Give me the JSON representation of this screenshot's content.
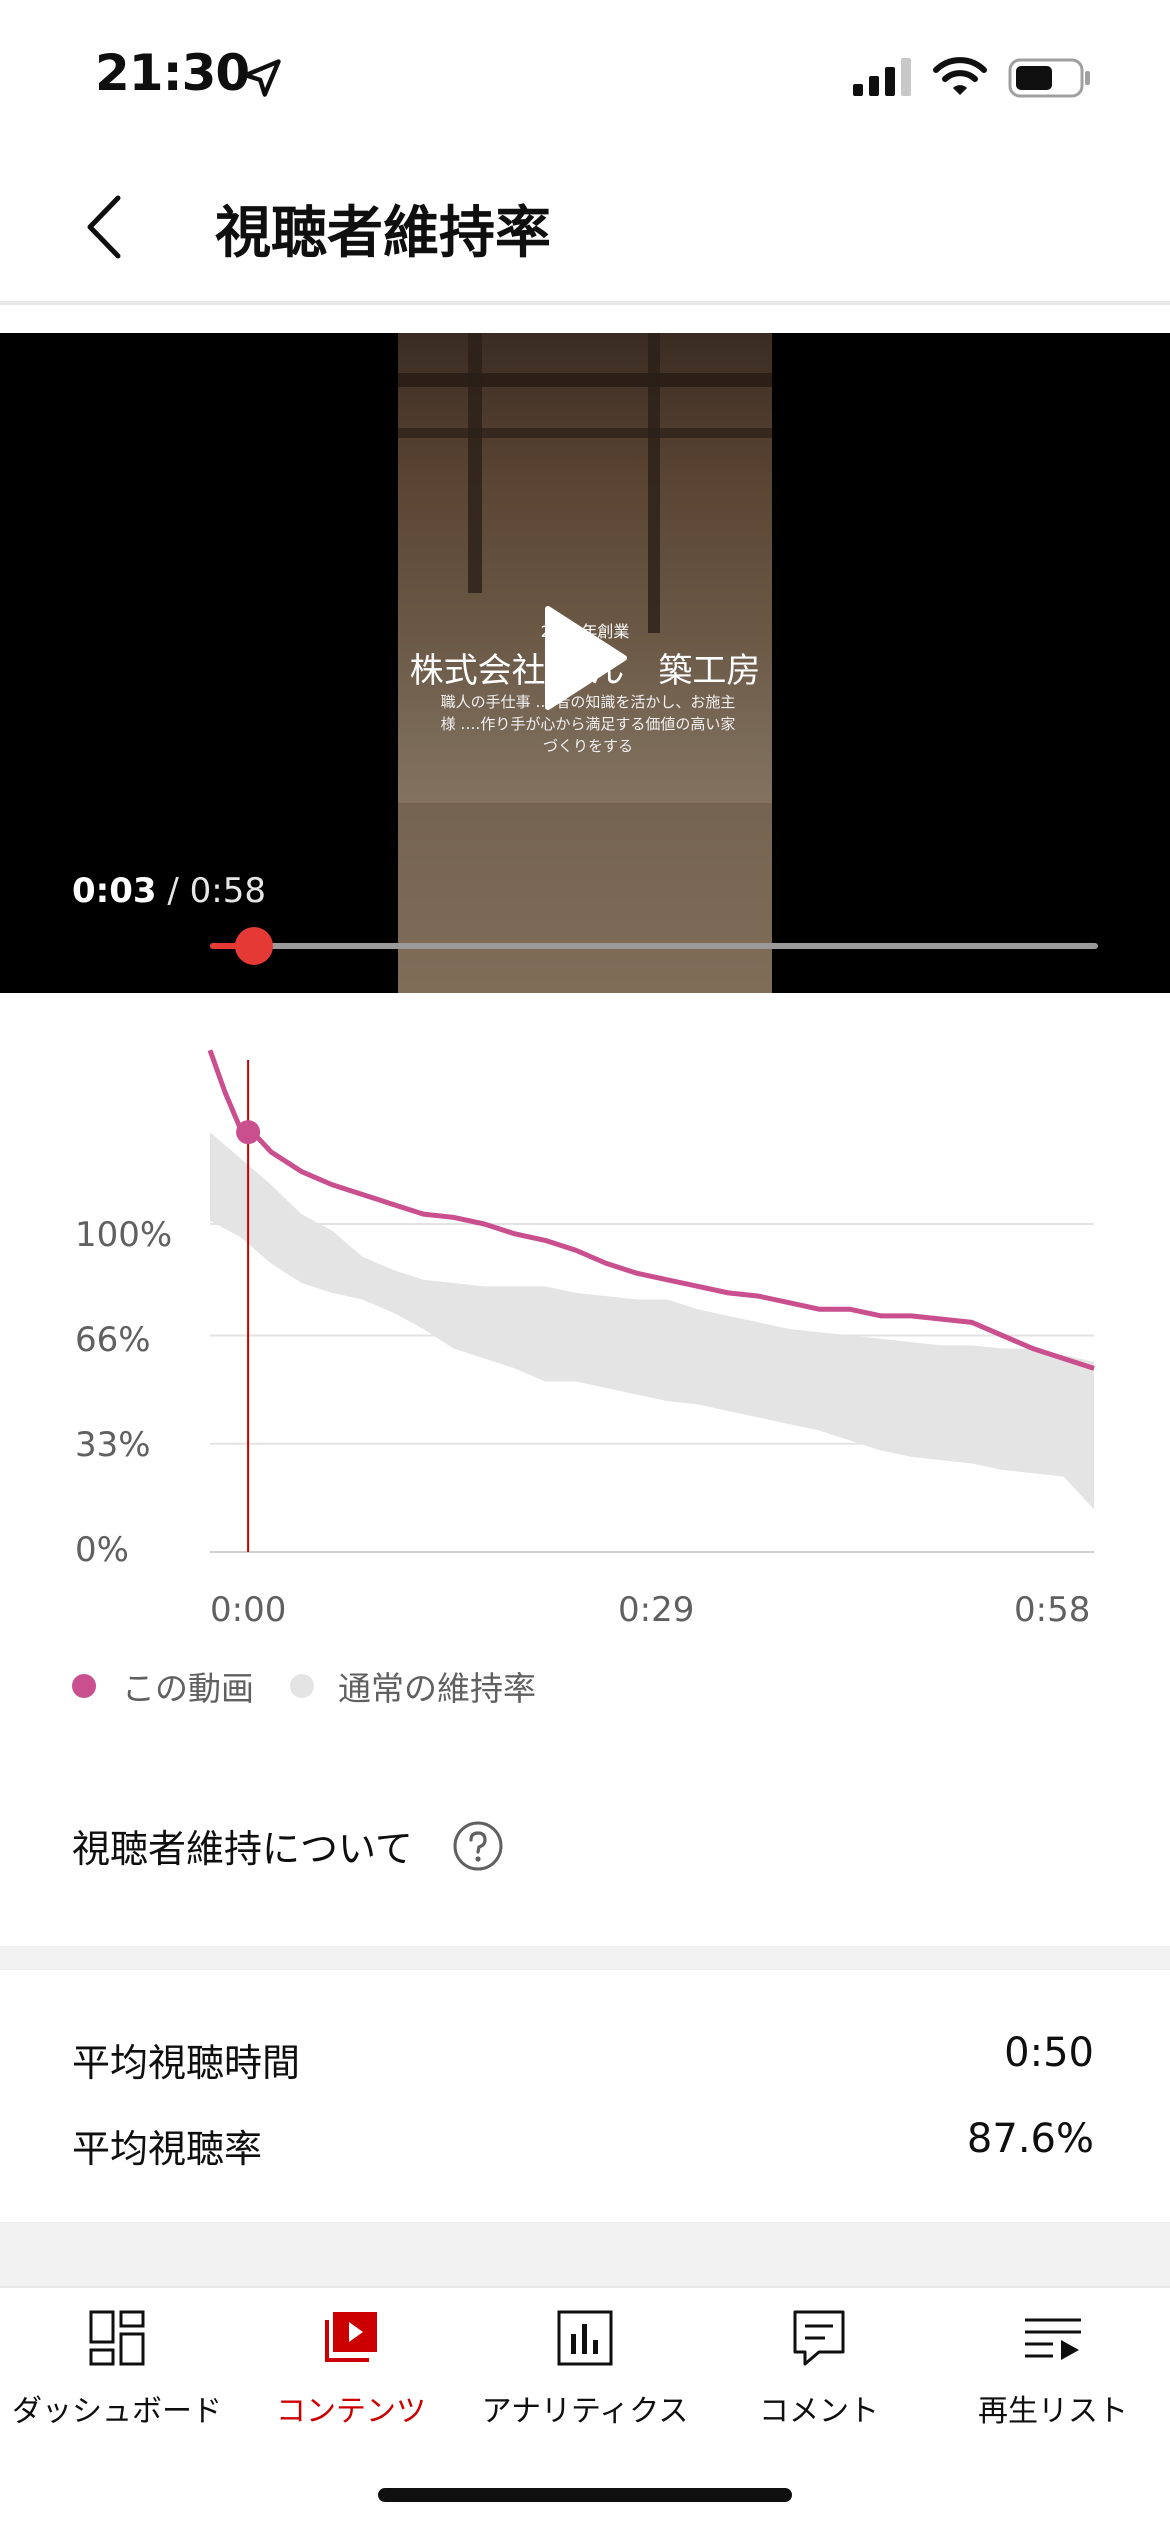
{
  "status_bar": {
    "time": "21:30"
  },
  "header": {
    "title": "視聴者維持率"
  },
  "video": {
    "overlay_top": "2020年創業",
    "overlay_title": "株式会社 なん　築工房",
    "overlay_sub": "職人の手仕事 ‥‥者の知識を活かし、お施主様 ‥‥作り手が心から満足する価値の高い家づくりをする",
    "current_time": "0:03",
    "separator": " / ",
    "duration": "0:58",
    "progress": 0.05
  },
  "chart_data": {
    "type": "line",
    "x_ticks": [
      "0:00",
      "0:29",
      "0:58"
    ],
    "y_ticks": [
      "100%",
      "66%",
      "33%",
      "0%"
    ],
    "ylim": [
      0,
      150
    ],
    "xlim": [
      0,
      58
    ],
    "grid": true,
    "legend_position": "bottom-left",
    "marker_x": 2.5,
    "series": [
      {
        "name": "この動画",
        "color": "#c94f8f",
        "x": [
          0,
          1,
          2,
          3,
          4,
          6,
          8,
          10,
          12,
          14,
          16,
          18,
          20,
          22,
          24,
          26,
          28,
          30,
          32,
          34,
          36,
          38,
          40,
          42,
          44,
          46,
          48,
          50,
          52,
          54,
          56,
          58
        ],
        "values": [
          153,
          140,
          129,
          127,
          122,
          116,
          112,
          109,
          106,
          103,
          102,
          100,
          97,
          95,
          92,
          88,
          85,
          83,
          81,
          79,
          78,
          76,
          74,
          74,
          72,
          72,
          71,
          70,
          66,
          62,
          59,
          56
        ]
      },
      {
        "name": "通常の維持率",
        "color": "#e4e4e4",
        "x": [
          0,
          2,
          4,
          6,
          8,
          10,
          12,
          14,
          16,
          18,
          20,
          22,
          24,
          26,
          28,
          30,
          32,
          34,
          36,
          38,
          40,
          42,
          44,
          46,
          48,
          50,
          52,
          54,
          56,
          58
        ],
        "upper": [
          128,
          120,
          112,
          103,
          98,
          90,
          86,
          83,
          82,
          81,
          81,
          81,
          79,
          78,
          77,
          77,
          74,
          72,
          70,
          68,
          67,
          66,
          65,
          64,
          63,
          63,
          62,
          62,
          60,
          58
        ],
        "lower": [
          101,
          96,
          88,
          82,
          79,
          77,
          73,
          68,
          62,
          59,
          56,
          52,
          52,
          50,
          48,
          46,
          45,
          43,
          41,
          39,
          37,
          34,
          31,
          29,
          28,
          27,
          25,
          24,
          23,
          13
        ]
      }
    ]
  },
  "about": {
    "label": "視聴者維持について"
  },
  "stats": [
    {
      "label": "平均視聴時間",
      "value": "0:50"
    },
    {
      "label": "平均視聴率",
      "value": "87.6%"
    }
  ],
  "bottom_nav": [
    {
      "label": "ダッシュボード",
      "icon": "dashboard-icon",
      "active": false
    },
    {
      "label": "コンテンツ",
      "icon": "content-icon",
      "active": true
    },
    {
      "label": "アナリティクス",
      "icon": "analytics-icon",
      "active": false
    },
    {
      "label": "コメント",
      "icon": "comment-icon",
      "active": false
    },
    {
      "label": "再生リスト",
      "icon": "playlist-icon",
      "active": false
    }
  ],
  "colors": {
    "accent": "#cc0000",
    "progress": "#e53935",
    "series_line": "#c94f8f",
    "band": "#e4e4e4"
  }
}
